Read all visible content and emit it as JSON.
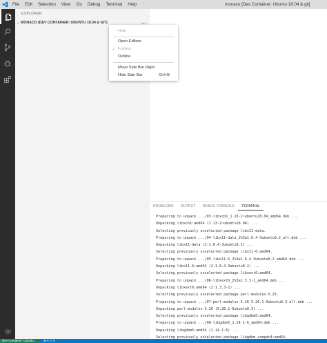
{
  "window": {
    "title": "monaco [Dev Container: Ubuntu 18.04 & git]",
    "menu": [
      "File",
      "Edit",
      "Selection",
      "View",
      "Go",
      "Debug",
      "Terminal",
      "Help"
    ],
    "accent_color": "#007acc",
    "logo_icon": "vscode-logo-icon"
  },
  "activity_bar": {
    "items": [
      {
        "icon": "explorer-files-icon",
        "active": true
      },
      {
        "icon": "search-icon",
        "active": false
      },
      {
        "icon": "source-control-icon",
        "active": false
      },
      {
        "icon": "debug-bug-icon",
        "active": false
      },
      {
        "icon": "extensions-icon",
        "active": false
      }
    ],
    "bottom_icon": "gear-icon"
  },
  "sidebar": {
    "header": "EXPLORER",
    "section_title": "MONACO (DEV CONTAINER: UBUNTU 18.04 & GIT)"
  },
  "context_menu": {
    "items": [
      {
        "label": "Hide",
        "disabled": true,
        "checked": false,
        "shortcut": ""
      },
      {
        "label": "Open Editors",
        "disabled": false,
        "checked": false,
        "shortcut": ""
      },
      {
        "label": "Folders",
        "disabled": true,
        "checked": true,
        "shortcut": ""
      },
      {
        "label": "Outline",
        "disabled": false,
        "checked": false,
        "shortcut": ""
      },
      {
        "label": "Move Side Bar Right",
        "disabled": false,
        "checked": false,
        "shortcut": ""
      },
      {
        "label": "Hide Side Bar",
        "disabled": false,
        "checked": false,
        "shortcut": "Ctrl+B"
      }
    ]
  },
  "panel": {
    "tabs": [
      "PROBLEMS",
      "OUTPUT",
      "DEBUG CONSOLE",
      "TERMINAL"
    ],
    "active_tab": "TERMINAL",
    "terminal_lines": [
      "Preparing to unpack .../03-libxcb1_1.13-2~ubuntu18.04_amd64.deb ...",
      "Unpacking libxcb1:amd64 (1.13-2~ubuntu18.04) ...",
      "Selecting previously unselected package libx11-data.",
      "Preparing to unpack .../04-libx11-data_2%3a1.6.4-3ubuntu0.2_all.deb ...",
      "Unpacking libx11-data (2:1.6.4-3ubuntu0.2) ...",
      "Selecting previously unselected package libx11-6:amd64.",
      "Preparing to unpack .../05-libx11-6_2%3a1.6.4-3ubuntu0.2_amd64.deb ...",
      "Unpacking libx11-6:amd64 (2:1.6.4-3ubuntu0.2) ...",
      "Selecting previously unselected package libxext6:amd64.",
      "Preparing to unpack .../06-libxext6_2%3a1.3.3-1_amd64.deb ...",
      "Unpacking libxext6:amd64 (2:1.3.3-1) ...",
      "Selecting previously unselected package perl-modules-5.26.",
      "Preparing to unpack .../07-perl-modules-5.26_5.26.1-6ubuntu0.3_all.deb ...",
      "Unpacking perl-modules-5.26 (5.26.1-6ubuntu0.3) ...",
      "Selecting previously unselected package libgdbm5:amd64.",
      "Preparing to unpack .../08-libgdbm5_1.14.1-6_amd64.deb ...",
      "Unpacking libgdbm5:amd64 (1.14.1-6) ...",
      "Selecting previously unselected package libgdbm-compat4:amd64."
    ]
  },
  "status_bar": {
    "remote_label": "Dev Container: Ubuntu...",
    "problems": "⊗ 0 ⚠ 0",
    "remote_color": "#16825d"
  }
}
